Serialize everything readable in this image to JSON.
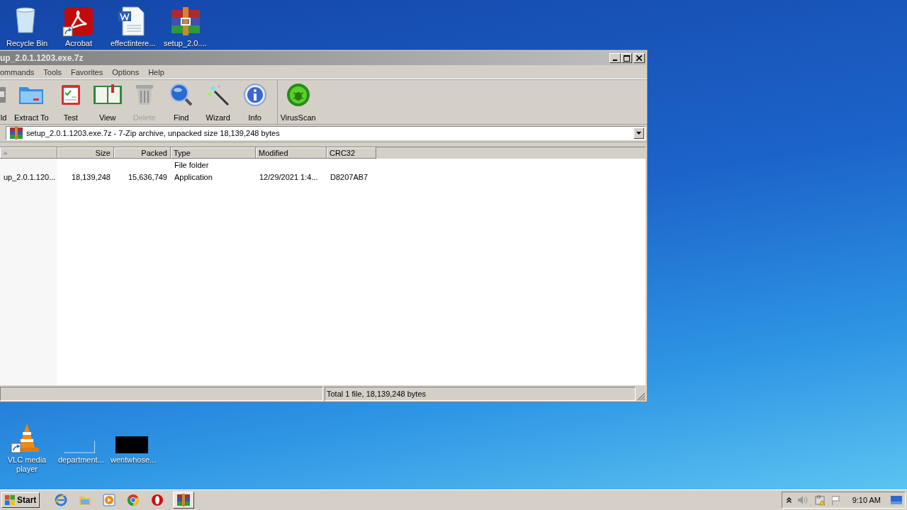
{
  "desktop_icons": [
    {
      "label": "Recycle Bin",
      "kind": "recycle",
      "shortcut": false
    },
    {
      "label": "Acrobat",
      "kind": "acrobat",
      "shortcut": true
    },
    {
      "label": "effectintere...",
      "kind": "word",
      "shortcut": false
    },
    {
      "label": "setup_2.0....",
      "kind": "winrar",
      "shortcut": false
    },
    {
      "label": "VLC media player",
      "kind": "vlc",
      "shortcut": true
    },
    {
      "label": "department...",
      "kind": "blank",
      "shortcut": false
    },
    {
      "label": "wentwhose...",
      "kind": "black",
      "shortcut": false
    }
  ],
  "window": {
    "title": "up_2.0.1.1203.exe.7z",
    "menu": [
      "ommands",
      "Tools",
      "Favorites",
      "Options",
      "Help"
    ],
    "toolbar": [
      [
        {
          "label": "ld",
          "kind": "add",
          "disabled": false
        },
        {
          "label": "Extract To",
          "kind": "extract",
          "disabled": false
        },
        {
          "label": "Test",
          "kind": "test",
          "disabled": false
        },
        {
          "label": "View",
          "kind": "view",
          "disabled": false
        },
        {
          "label": "Delete",
          "kind": "delete",
          "disabled": true
        },
        {
          "label": "Find",
          "kind": "find",
          "disabled": false
        },
        {
          "label": "Wizard",
          "kind": "wizard",
          "disabled": false
        },
        {
          "label": "Info",
          "kind": "info",
          "disabled": false
        }
      ],
      [
        {
          "label": "VirusScan",
          "kind": "virusscan",
          "disabled": false
        }
      ]
    ],
    "address": "setup_2.0.1.1203.exe.7z - 7-Zip archive, unpacked size 18,139,248 bytes",
    "columns": [
      "Size",
      "Packed",
      "Type",
      "Modified",
      "CRC32"
    ],
    "rows": [
      {
        "name": "",
        "size": "",
        "packed": "",
        "type": "File folder",
        "modified": "",
        "crc": ""
      },
      {
        "name": "up_2.0.1.120...",
        "size": "18,139,248",
        "packed": "15,636,749",
        "type": "Application",
        "modified": "12/29/2021 1:4...",
        "crc": "D8207AB7"
      }
    ],
    "status": "Total 1 file, 18,139,248 bytes"
  },
  "taskbar": {
    "start": "Start",
    "apps": [
      {
        "kind": "ie",
        "selected": false
      },
      {
        "kind": "explorer",
        "selected": false
      },
      {
        "kind": "media",
        "selected": false
      },
      {
        "kind": "chrome",
        "selected": false
      },
      {
        "kind": "opera",
        "selected": false
      },
      {
        "kind": "winrar",
        "selected": true
      }
    ],
    "clock": "9:10 AM"
  }
}
